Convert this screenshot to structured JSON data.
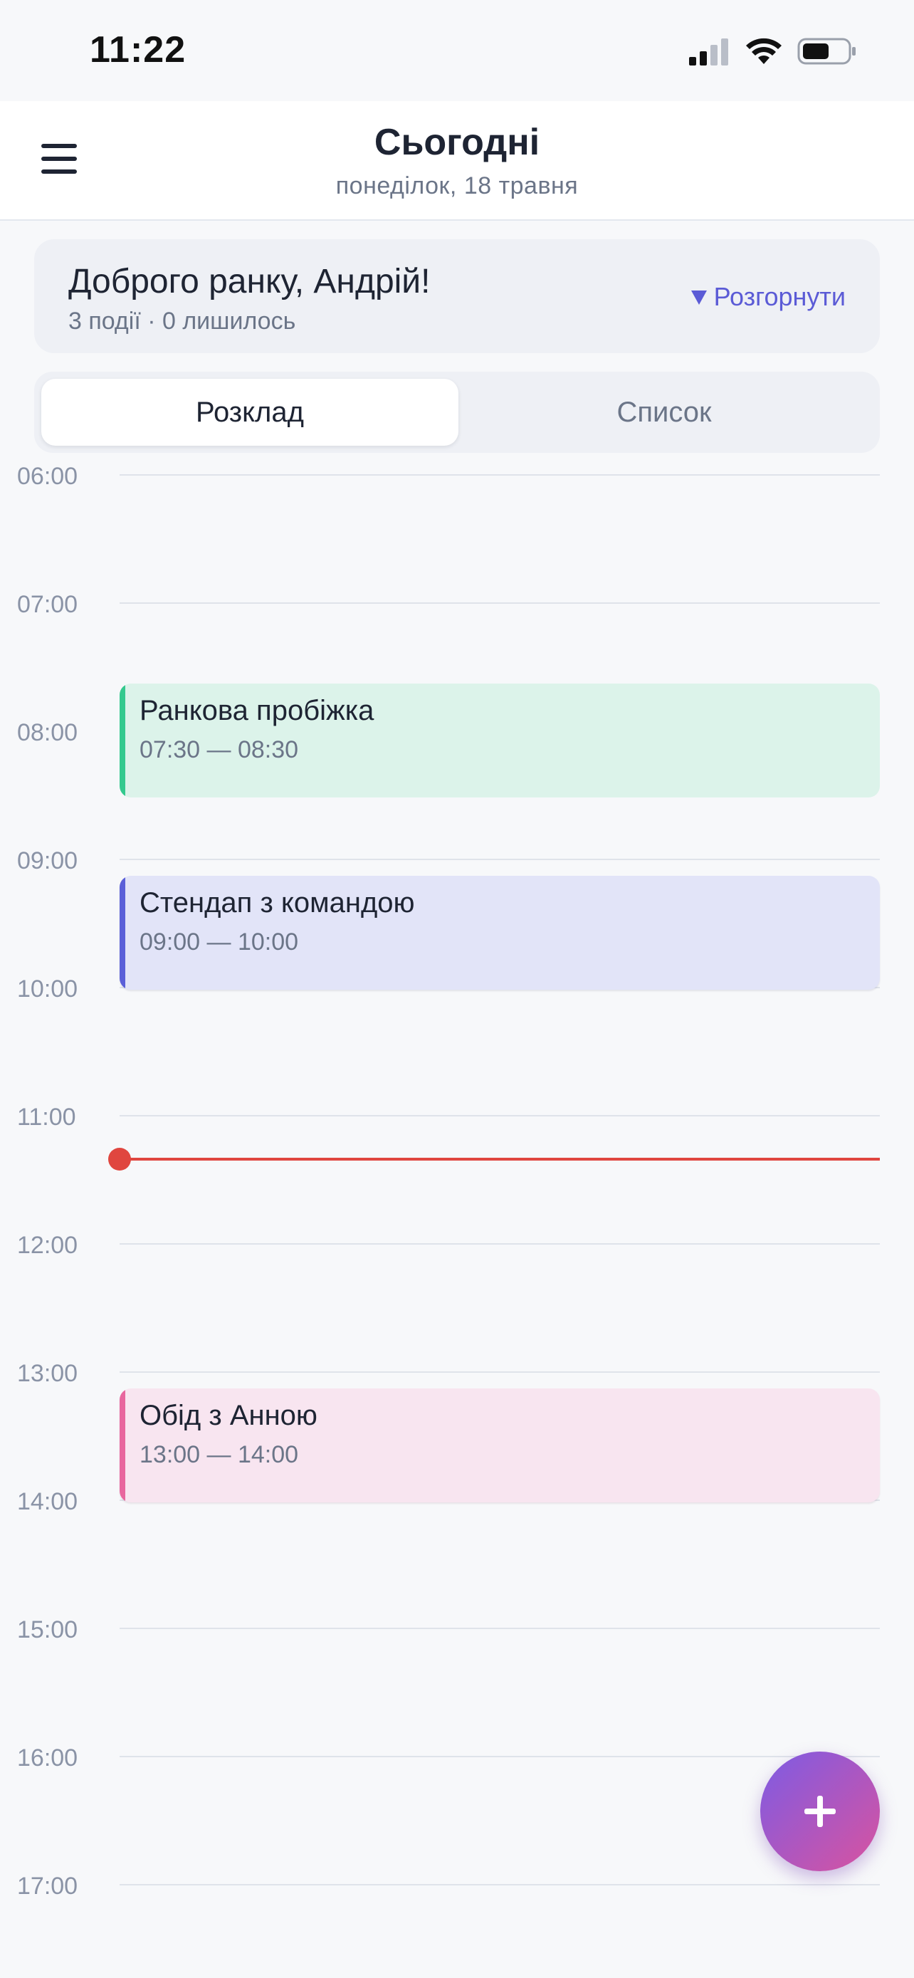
{
  "status_bar": {
    "time": "11:22",
    "icons": [
      "cellular-signal-icon",
      "wifi-icon",
      "battery-icon"
    ]
  },
  "header": {
    "title": "Сьогодні",
    "subtitle": "понеділок, 18 травня",
    "menu_icon": "hamburger-menu-icon"
  },
  "greeting": {
    "title": "Доброго ранку, Андрій!",
    "meta": "3 події · 0 лишилось",
    "expand_label": "Розгорнути"
  },
  "view_switch": {
    "options": [
      "Розклад",
      "Список"
    ],
    "selected": "Розклад"
  },
  "timeline": {
    "hours": [
      "06:00",
      "07:00",
      "08:00",
      "09:00",
      "10:00",
      "11:00",
      "12:00",
      "13:00",
      "14:00",
      "15:00",
      "16:00",
      "17:00"
    ],
    "current_time": "11:22"
  },
  "events": [
    {
      "title": "Ранкова пробіжка",
      "time": "07:30 — 08:30",
      "color": "#34c98e"
    },
    {
      "title": "Стендап з командою",
      "time": "09:00 — 10:00",
      "color": "#5a5fd8"
    },
    {
      "title": "Обід з Анною",
      "time": "13:00 — 14:00",
      "color": "#e8669e"
    }
  ],
  "colors": {
    "accent": "#5b5bd6",
    "now_indicator": "#e0463f",
    "fab_gradient_start": "#7d5be4",
    "fab_gradient_end": "#d9539f"
  },
  "fab": {
    "icon": "plus-icon"
  }
}
